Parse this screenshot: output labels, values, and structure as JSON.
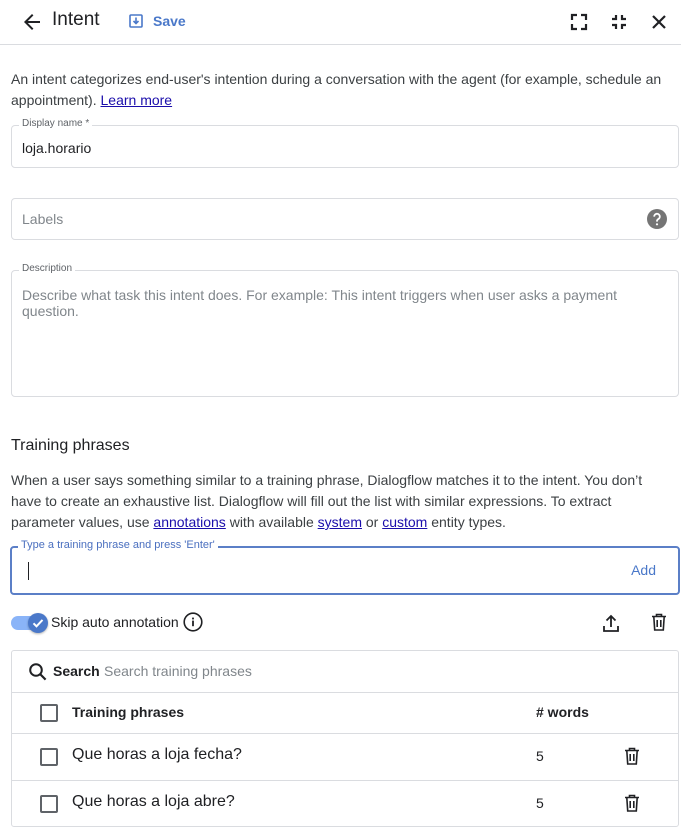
{
  "header": {
    "title": "Intent",
    "save_label": "Save"
  },
  "intro": {
    "text": "An intent categorizes end-user's intention during a conversation with the agent (for example, schedule an appointment). ",
    "learn_more": "Learn more"
  },
  "display_name": {
    "label": "Display name *",
    "value": "loja.horario"
  },
  "labels_field": {
    "placeholder": "Labels"
  },
  "description": {
    "label": "Description",
    "placeholder": "Describe what task this intent does. For example: This intent triggers when user asks a payment question."
  },
  "training": {
    "title": "Training phrases",
    "desc_part1": "When a user says something similar to a training phrase, Dialogflow matches it to the intent. You don’t have to create an exhaustive list. Dialogflow will fill out the list with similar expressions. To extract parameter values, use ",
    "annotations_link": "annotations",
    "desc_part2": " with available ",
    "system_link": "system",
    "desc_part3": " or ",
    "custom_link": "custom",
    "desc_part4": " entity types.",
    "input_label": "Type a training phrase and press 'Enter'",
    "add_label": "Add",
    "skip_label": "Skip auto annotation",
    "skip_enabled": true,
    "search_label": "Search",
    "search_placeholder": "Search training phrases",
    "col_phrases": "Training phrases",
    "col_words": "# words",
    "rows": [
      {
        "phrase": "Que horas a loja fecha?",
        "words": "5"
      },
      {
        "phrase": "Que horas a loja abre?",
        "words": "5"
      }
    ]
  },
  "colors": {
    "accent": "#4a78c9",
    "link": "#1a0dab",
    "border": "#dadce0"
  }
}
